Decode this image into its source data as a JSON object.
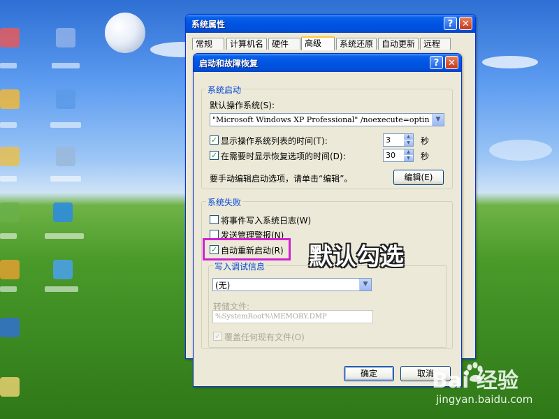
{
  "outer_window": {
    "title": "系统属性",
    "help_label": "?",
    "close_label": "✕",
    "tabs": [
      "常规",
      "计算机名",
      "硬件",
      "高级",
      "系统还原",
      "自动更新",
      "远程"
    ],
    "active_tab": "高级"
  },
  "dialog": {
    "title": "启动和故障恢复",
    "help_label": "?",
    "close_label": "✕",
    "startup_group": {
      "legend": "系统启动",
      "default_os_label": "默认操作系统(S):",
      "default_os_value": "\"Microsoft Windows XP Professional\" /noexecute=optin",
      "show_os_list_label": "显示操作系统列表的时间(T):",
      "show_os_list_checked": true,
      "show_os_list_value": "3",
      "show_recovery_label": "在需要时显示恢复选项的时间(D):",
      "show_recovery_checked": true,
      "show_recovery_value": "30",
      "seconds_unit": "秒",
      "manual_edit_text": "要手动编辑启动选项，请单击“编辑”。",
      "edit_button": "编辑(E)"
    },
    "failure_group": {
      "legend": "系统失败",
      "write_event_label": "将事件写入系统日志(W)",
      "write_event_checked": false,
      "send_alert_label": "发送管理警报(N)",
      "send_alert_checked": false,
      "auto_restart_label": "自动重新启动(R)",
      "auto_restart_checked": true
    },
    "debug_group": {
      "legend": "写入调试信息",
      "debug_type_value": "(无)",
      "dump_file_label": "转储文件:",
      "dump_file_value": "%SystemRoot%\\MEMORY.DMP",
      "overwrite_label": "覆盖任何现有文件(O)",
      "overwrite_checked": true
    },
    "ok_button": "确定",
    "cancel_button": "取消"
  },
  "annotation": {
    "text": "默认勾选",
    "highlight_color": "#d020d0"
  },
  "watermark": {
    "brand": "Bai  经验",
    "url": "jingyan.baidu.com"
  },
  "colors": {
    "titlebar_blue": "#0054e3",
    "dialog_bg": "#ece9d8",
    "group_legend": "#0046d5",
    "check_green": "#21a121"
  }
}
